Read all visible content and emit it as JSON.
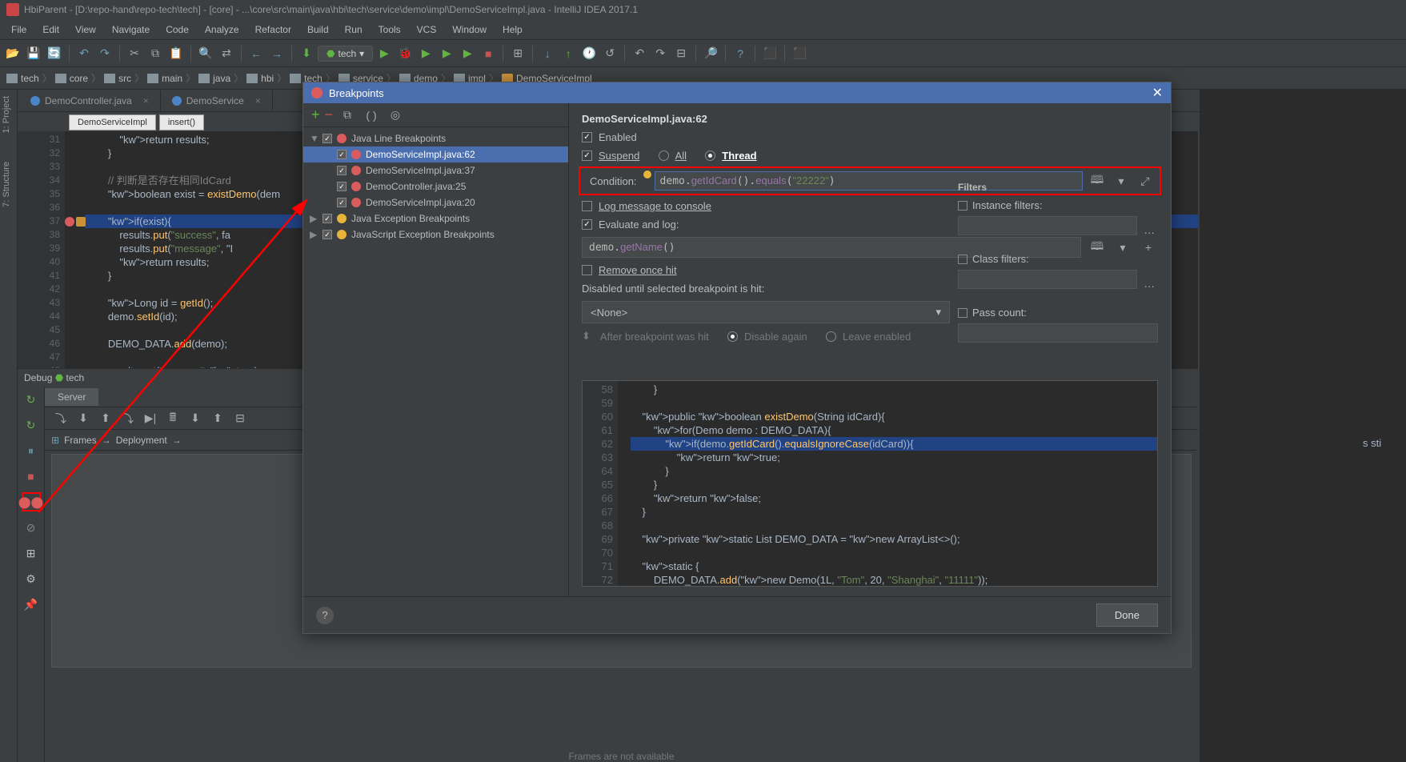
{
  "titlebar": "HbiParent - [D:\\repo-hand\\repo-tech\\tech] - [core] - ...\\core\\src\\main\\java\\hbi\\tech\\service\\demo\\impl\\DemoServiceImpl.java - IntelliJ IDEA 2017.1",
  "menu": [
    "File",
    "Edit",
    "View",
    "Navigate",
    "Code",
    "Analyze",
    "Refactor",
    "Build",
    "Run",
    "Tools",
    "VCS",
    "Window",
    "Help"
  ],
  "runConfig": "tech",
  "breadcrumbs": [
    "tech",
    "core",
    "src",
    "main",
    "java",
    "hbi",
    "tech",
    "service",
    "demo",
    "impl",
    "DemoServiceImpl"
  ],
  "editorTabs": [
    {
      "label": "DemoController.java",
      "active": false
    },
    {
      "label": "DemoService",
      "active": false
    }
  ],
  "methodChips": [
    "DemoServiceImpl",
    "insert()"
  ],
  "codeLines": [
    {
      "n": 31,
      "t": "            return results;"
    },
    {
      "n": 32,
      "t": "        }"
    },
    {
      "n": 33,
      "t": ""
    },
    {
      "n": 34,
      "t": "        // 判断是否存在相同IdCard",
      "cmt": true
    },
    {
      "n": 35,
      "t": "        boolean exist = existDemo(dem"
    },
    {
      "n": 36,
      "t": ""
    },
    {
      "n": 37,
      "t": "        if(exist){",
      "hl": true,
      "bp": true
    },
    {
      "n": 38,
      "t": "            results.put(\"success\", fa"
    },
    {
      "n": 39,
      "t": "            results.put(\"message\", \"I"
    },
    {
      "n": 40,
      "t": "            return results;"
    },
    {
      "n": 41,
      "t": "        }"
    },
    {
      "n": 42,
      "t": ""
    },
    {
      "n": 43,
      "t": "        Long id = getId();"
    },
    {
      "n": 44,
      "t": "        demo.setId(id);"
    },
    {
      "n": 45,
      "t": ""
    },
    {
      "n": 46,
      "t": "        DEMO_DATA.add(demo);"
    },
    {
      "n": 47,
      "t": ""
    },
    {
      "n": 48,
      "t": "        results.put(\"success\", true);"
    }
  ],
  "debug": {
    "title": "Debug",
    "config": "tech",
    "serverTab": "Server",
    "framesTab": "Frames",
    "deployTab": "Deployment",
    "empty": "Frames are not available"
  },
  "bpDialog": {
    "title": "Breakpoints",
    "groups": [
      {
        "label": "Java Line Breakpoints",
        "children": [
          {
            "label": "DemoServiceImpl.java:62",
            "selected": true
          },
          {
            "label": "DemoServiceImpl.java:37"
          },
          {
            "label": "DemoController.java:25"
          },
          {
            "label": "DemoServiceImpl.java:20"
          }
        ]
      },
      {
        "label": "Java Exception Breakpoints"
      },
      {
        "label": "JavaScript Exception Breakpoints"
      }
    ],
    "detailTitle": "DemoServiceImpl.java:62",
    "enabled": "Enabled",
    "suspend": "Suspend",
    "all": "All",
    "thread": "Thread",
    "condition": "Condition:",
    "conditionExpr": "demo.getIdCard().equals(\"22222\")",
    "logMsg": "Log message to console",
    "evalLog": "Evaluate and log:",
    "evalExpr": "demo.getName()",
    "removeOnce": "Remove once hit",
    "disabledUntil": "Disabled until selected breakpoint is hit:",
    "none": "<None>",
    "afterHit": "After breakpoint was hit",
    "disableAgain": "Disable again",
    "leaveEnabled": "Leave enabled",
    "filters": "Filters",
    "instance": "Instance filters:",
    "class": "Class filters:",
    "pass": "Pass count:",
    "done": "Done",
    "previewLines": [
      {
        "n": 58,
        "t": "        }"
      },
      {
        "n": 59,
        "t": ""
      },
      {
        "n": 60,
        "t": "    public boolean existDemo(String idCard){"
      },
      {
        "n": 61,
        "t": "        for(Demo demo : DEMO_DATA){"
      },
      {
        "n": 62,
        "t": "            if(demo.getIdCard().equalsIgnoreCase(idCard)){",
        "hl": true,
        "bp": true
      },
      {
        "n": 63,
        "t": "                return true;"
      },
      {
        "n": 64,
        "t": "            }"
      },
      {
        "n": 65,
        "t": "        }"
      },
      {
        "n": 66,
        "t": "        return false;"
      },
      {
        "n": 67,
        "t": "    }"
      },
      {
        "n": 68,
        "t": ""
      },
      {
        "n": 69,
        "t": "    private static List<Demo> DEMO_DATA = new ArrayList<>();"
      },
      {
        "n": 70,
        "t": ""
      },
      {
        "n": 71,
        "t": "    static {"
      },
      {
        "n": 72,
        "t": "        DEMO_DATA.add(new Demo(1L, \"Tom\", 20, \"Shanghai\", \"11111\"));"
      }
    ]
  },
  "rightMargin": "s sti"
}
